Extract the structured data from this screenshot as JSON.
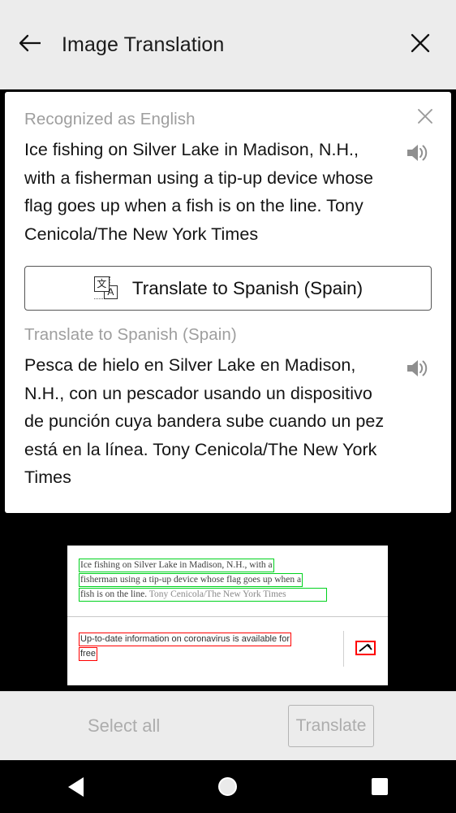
{
  "appbar": {
    "back_icon": "arrow-left-icon",
    "title": "Image Translation",
    "close_icon": "close-icon"
  },
  "dialog": {
    "close_icon": "close-icon",
    "source": {
      "language_label": "Recognized as English",
      "text": "Ice fishing on Silver Lake in Madison, N.H., with a fisherman using a tip-up device whose flag goes up when a fish is on the line. Tony Cenicola/The New York Times",
      "speaker_icon": "volume-speaker-icon"
    },
    "translate_button": {
      "label": "Translate to Spanish (Spain)",
      "icon": "translate-icon",
      "icon_cjk_glyph": "文",
      "icon_latin_glyph": "A"
    },
    "target": {
      "language_label": "Translate to Spanish (Spain)",
      "text": "Pesca de hielo en Silver Lake en Madison, N.H., con un pescador usando un dispositivo de punción cuya bandera sube cuando un pez está en la línea. Tony Cenicola/The New York Times",
      "speaker_icon": "volume-speaker-icon"
    }
  },
  "document": {
    "block_a": {
      "lines": [
        "Ice fishing on Silver Lake in Madison, N.H., with a",
        "fisherman using a tip-up device whose flag goes up when a",
        "fish is on the line.",
        "Tony Cenicola/The New York Times"
      ],
      "highlight_color": "#00d21e"
    },
    "block_b": {
      "lines": [
        "Up-to-date information on coronavirus is available for",
        "free"
      ],
      "highlight_color": "#ff0000",
      "broken_image_icon": "broken-image-icon"
    }
  },
  "bottombar": {
    "select_all_label": "Select all",
    "translate_label": "Translate"
  },
  "navbar": {
    "back_icon": "nav-back-icon",
    "home_icon": "nav-home-icon",
    "recents_icon": "nav-recents-icon"
  },
  "colors": {
    "chrome": "#ececec",
    "backdrop": "#000000",
    "dialog": "#ffffff",
    "muted_text": "#9e9e9e",
    "body_text": "#141414",
    "ocr_green": "#00d21e",
    "ocr_red": "#ff0000"
  }
}
